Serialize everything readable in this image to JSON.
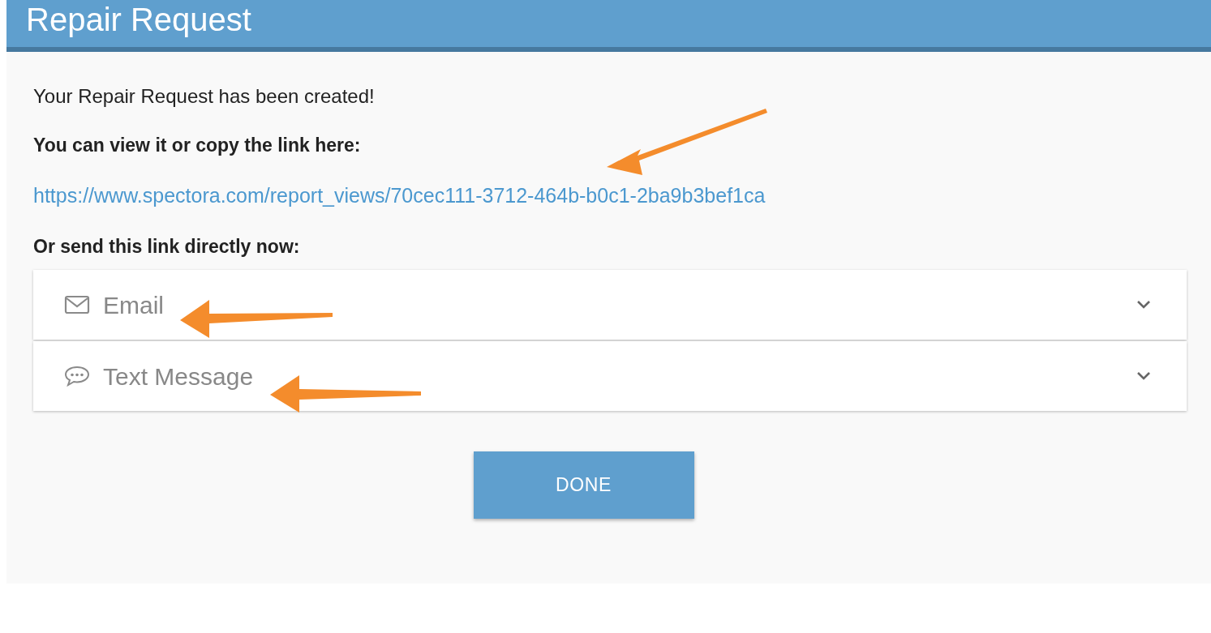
{
  "header": {
    "title": "Repair Request"
  },
  "message": "Your Repair Request has been created!",
  "link_heading": "You can view it or copy the link here:",
  "link": "https://www.spectora.com/report_views/70cec111-3712-464b-b0c1-2ba9b3bef1ca",
  "send_heading": "Or send this link directly now:",
  "send_options": [
    {
      "kind": "email",
      "label": "Email",
      "expanded": false
    },
    {
      "kind": "sms",
      "label": "Text Message",
      "expanded": false
    }
  ],
  "done_button": "DONE"
}
